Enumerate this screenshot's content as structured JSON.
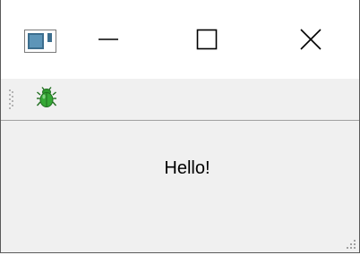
{
  "window": {
    "app_icon": "application-window-icon",
    "controls": {
      "minimize_icon": "minimize-icon",
      "maximize_icon": "maximize-icon",
      "close_icon": "close-icon"
    }
  },
  "toolbar": {
    "debug_icon": "bug-icon"
  },
  "content": {
    "label": "Hello!"
  },
  "colors": {
    "title_bar": "#ffffff",
    "client_area": "#f0f0f0",
    "bug_green": "#2e9a2e",
    "toolbar_border": "#a0a0a0"
  }
}
